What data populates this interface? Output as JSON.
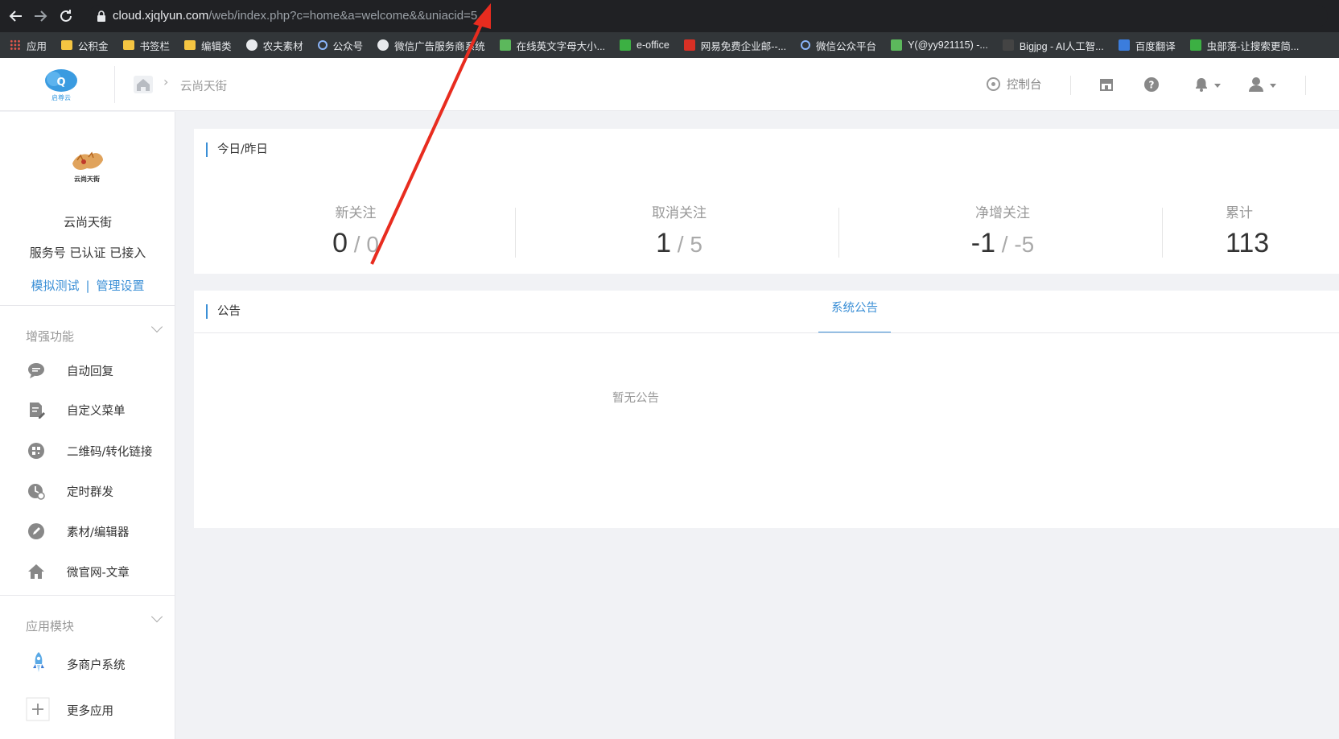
{
  "browser": {
    "url_host": "cloud.xjqlyun.com",
    "url_path": "/web/index.php?c=home&a=welcome&&uniacid=5",
    "bookmarks": [
      {
        "label": "应用",
        "icon": "apps-grid-icon",
        "color": "#e2574c"
      },
      {
        "label": "公积金",
        "icon": "folder-icon",
        "color": "#f5c542"
      },
      {
        "label": "书签栏",
        "icon": "folder-icon",
        "color": "#f5c542"
      },
      {
        "label": "编辑类",
        "icon": "folder-icon",
        "color": "#f5c542"
      },
      {
        "label": "农夫素材",
        "icon": "globe-icon",
        "color": "#e8eaed"
      },
      {
        "label": "公众号",
        "icon": "link-icon",
        "color": "#8ab4f8"
      },
      {
        "label": "微信广告服务商系统",
        "icon": "globe-icon",
        "color": "#e8eaed"
      },
      {
        "label": "在线英文字母大小...",
        "icon": "frog-icon",
        "color": "#5cb85c"
      },
      {
        "label": "e-office",
        "icon": "eoffice-icon",
        "color": "#3cb043"
      },
      {
        "label": "网易免费企业邮--...",
        "icon": "netease-icon",
        "color": "#d93025"
      },
      {
        "label": "微信公众平台",
        "icon": "link-icon",
        "color": "#8ab4f8"
      },
      {
        "label": "Y(@yy921115) -...",
        "icon": "wechat-icon",
        "color": "#5cb85c"
      },
      {
        "label": "Bigjpg - AI人工智...",
        "icon": "b-icon",
        "color": "#444"
      },
      {
        "label": "百度翻译",
        "icon": "translate-icon",
        "color": "#3b7ddd"
      },
      {
        "label": "虫部落-让搜索更简...",
        "icon": "q-icon",
        "color": "#3cb043"
      }
    ]
  },
  "header": {
    "breadcrumb_current": "云尚天街",
    "console_label": "控制台"
  },
  "sidebar": {
    "account_name": "云尚天街",
    "account_status": "服务号 已认证 已接入",
    "link_test": "模拟测试",
    "link_settings": "管理设置",
    "link_separator": "|",
    "section_enhance": "增强功能",
    "enhance_items": [
      {
        "label": "自动回复",
        "icon": "chat-bubble-icon"
      },
      {
        "label": "自定义菜单",
        "icon": "edit-document-icon"
      },
      {
        "label": "二维码/转化链接",
        "icon": "qrcode-icon"
      },
      {
        "label": "定时群发",
        "icon": "clock-icon"
      },
      {
        "label": "素材/编辑器",
        "icon": "pencil-icon"
      },
      {
        "label": "微官网-文章",
        "icon": "home-icon"
      }
    ],
    "section_apps": "应用模块",
    "app_items": [
      {
        "label": "多商户系统",
        "icon": "rocket-icon"
      },
      {
        "label": "更多应用",
        "icon": "plus-icon"
      }
    ]
  },
  "stats": {
    "title": "今日/昨日",
    "items": [
      {
        "label": "新关注",
        "today": "0",
        "yesterday": "0"
      },
      {
        "label": "取消关注",
        "today": "1",
        "yesterday": "5"
      },
      {
        "label": "净增关注",
        "today": "-1",
        "yesterday": "-5"
      },
      {
        "label": "累计",
        "today": "113",
        "yesterday": ""
      }
    ]
  },
  "notice": {
    "title": "公告",
    "tab_label": "系统公告",
    "empty_text": "暂无公告"
  },
  "colors": {
    "accent": "#3b8fd6",
    "annotation_arrow": "#e82c1f"
  }
}
